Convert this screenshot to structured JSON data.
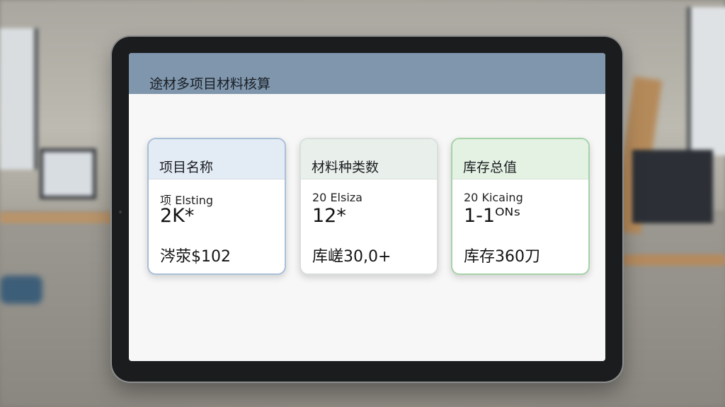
{
  "app": {
    "title": "途材多项目材料核算"
  },
  "cards": [
    {
      "header": "项目名称",
      "subtitle": "项 Elsting",
      "value": "2K*",
      "footer": "涔荥$102"
    },
    {
      "header": "材料种类数",
      "subtitle": "20 Elsiza",
      "value": "12*",
      "footer": "库嵯30,0+"
    },
    {
      "header": "库存总值",
      "subtitle": "20 Kicaing",
      "value": "1-1ᴼᴺˢ",
      "footer": "库存360刀"
    }
  ],
  "colors": {
    "titlebar": "#7f96ac",
    "card1_accent": "#a9bfd8",
    "card2_accent": "#d9dfdb",
    "card3_accent": "#a7d2a8"
  }
}
